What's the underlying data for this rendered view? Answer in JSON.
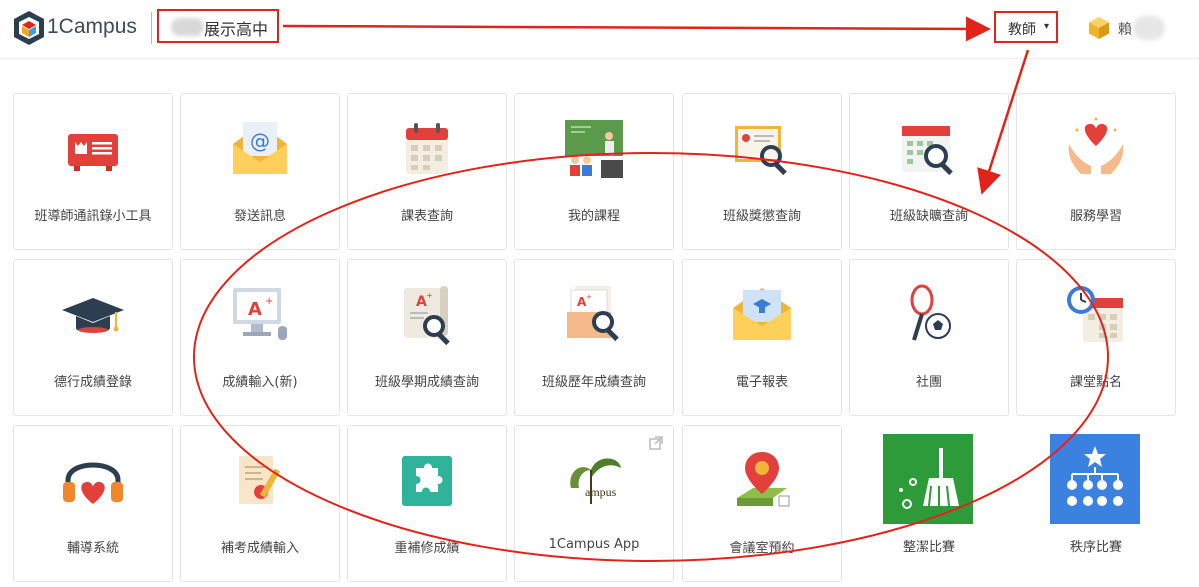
{
  "header": {
    "brand": "1Campus",
    "school_name": "展示高中",
    "role_label": "教師",
    "role_caret": "▾",
    "user_name": "賴"
  },
  "apps": [
    {
      "label": "班導師通訊錄小工具",
      "icon": "id-card-icon"
    },
    {
      "label": "發送訊息",
      "icon": "email-icon"
    },
    {
      "label": "課表查詢",
      "icon": "calendar-icon"
    },
    {
      "label": "我的課程",
      "icon": "classroom-icon"
    },
    {
      "label": "班級獎懲查詢",
      "icon": "certificate-search-icon"
    },
    {
      "label": "班級缺曠查詢",
      "icon": "calendar-search-icon"
    },
    {
      "label": "服務學習",
      "icon": "heart-hands-icon"
    },
    {
      "label": "德行成績登錄",
      "icon": "graduation-cap-icon"
    },
    {
      "label": "成績輸入(新)",
      "icon": "computer-grade-icon"
    },
    {
      "label": "班級學期成績查詢",
      "icon": "scroll-search-icon"
    },
    {
      "label": "班級歷年成績查詢",
      "icon": "folder-search-icon"
    },
    {
      "label": "電子報表",
      "icon": "envelope-report-icon"
    },
    {
      "label": "社團",
      "icon": "sports-icon"
    },
    {
      "label": "課堂點名",
      "icon": "clock-calendar-icon"
    },
    {
      "label": "輔導系統",
      "icon": "headphones-heart-icon"
    },
    {
      "label": "補考成績輸入",
      "icon": "document-pen-icon"
    },
    {
      "label": "重補修成績",
      "icon": "puzzle-icon"
    },
    {
      "label": "1Campus App",
      "icon": "campus-logo-icon",
      "logo_text": "ampus"
    },
    {
      "label": "會議室預約",
      "icon": "map-pin-icon"
    },
    {
      "label": "整潔比賽",
      "icon": "broom-icon"
    },
    {
      "label": "秩序比賽",
      "icon": "hierarchy-icon"
    }
  ],
  "colors": {
    "annotation": "#e2231a",
    "broom_tile": "#2e9b3a",
    "hierarchy_tile": "#3b82e0",
    "puzzle": "#2fb39a"
  }
}
